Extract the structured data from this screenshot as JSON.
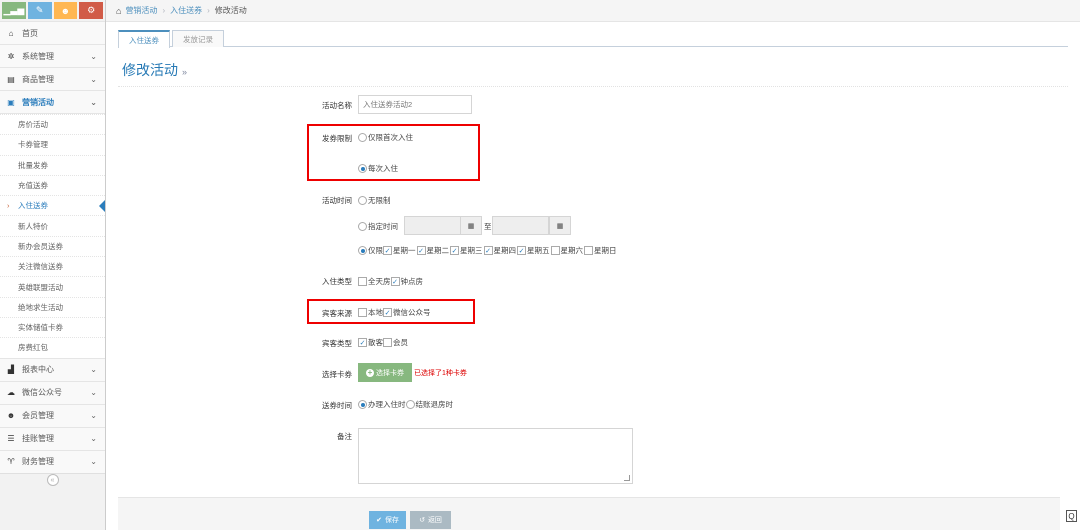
{
  "sidebar": {
    "shortcuts": [
      {
        "icon": "signal-icon",
        "glyph": "▁▃▅",
        "color": "#87b87f"
      },
      {
        "icon": "pencil-icon",
        "glyph": "✎",
        "color": "#6fb3e0"
      },
      {
        "icon": "users-icon",
        "glyph": "☻",
        "color": "#ffb752"
      },
      {
        "icon": "cogs-icon",
        "glyph": "⚙",
        "color": "#d15b47"
      }
    ],
    "items": [
      {
        "label": "首页",
        "icon": "home-icon",
        "glyph": "⌂"
      },
      {
        "label": "系统管理",
        "icon": "cog-icon",
        "glyph": "✲"
      },
      {
        "label": "商品管理",
        "icon": "database-icon",
        "glyph": "▤"
      },
      {
        "label": "营销活动",
        "icon": "gift-icon",
        "glyph": "▣"
      },
      {
        "label": "报表中心",
        "icon": "bar-chart-icon",
        "glyph": "▟"
      },
      {
        "label": "微信公众号",
        "icon": "cloud-icon",
        "glyph": "☁"
      },
      {
        "label": "会员管理",
        "icon": "group-icon",
        "glyph": "☻"
      },
      {
        "label": "挂账管理",
        "icon": "list-icon",
        "glyph": "☰"
      },
      {
        "label": "财务管理",
        "icon": "glass-icon",
        "glyph": "♈"
      }
    ],
    "submenu": [
      "房价活动",
      "卡券管理",
      "批量发券",
      "充值送券",
      "入住送券",
      "新人特价",
      "新办会员送券",
      "关注微信送券",
      "英雄联盟活动",
      "绝地求生活动",
      "实体储值卡券",
      "房费红包"
    ],
    "collapse_glyph": "«"
  },
  "breadcrumb": {
    "home_glyph": "⌂",
    "items": [
      "营销活动",
      "入住送券"
    ],
    "current": "修改活动",
    "sep": "›"
  },
  "tabs": [
    "入住送券",
    "发放记录"
  ],
  "page": {
    "title": "修改活动",
    "title_arrow": "»"
  },
  "form": {
    "name_label": "活动名称",
    "name_value": "入住送券活动2",
    "limit_label": "发券限制",
    "limit_opt1": "仅限首次入住",
    "limit_opt2": "每次入住",
    "time_label": "活动时间",
    "time_opt1": "无限制",
    "time_opt2": "指定时间",
    "time_to": "至",
    "cal_glyph": "▦",
    "time_opt3": "仅限",
    "weekdays": [
      "星期一",
      "星期二",
      "星期三",
      "星期四",
      "星期五",
      "星期六",
      "星期日"
    ],
    "weekdays_checked": [
      true,
      true,
      true,
      true,
      true,
      false,
      false
    ],
    "checkin_label": "入住类型",
    "checkin_opt1": "全天房",
    "checkin_opt2": "钟点房",
    "source_label": "宾客来源",
    "source_opt1": "本地",
    "source_opt2": "微信公众号",
    "guest_label": "宾客类型",
    "guest_opt1": "散客",
    "guest_opt2": "会员",
    "coupon_label": "选择卡券",
    "coupon_btn": "选择卡券",
    "coupon_note": "已选择了1种卡券",
    "send_label": "送券时间",
    "send_opt1": "办理入住时",
    "send_opt2": "结账退房时",
    "remark_label": "备注"
  },
  "footer": {
    "save": "保存",
    "save_glyph": "✔",
    "back": "返回",
    "back_glyph": "↺"
  },
  "zoom_glyph": "Q"
}
